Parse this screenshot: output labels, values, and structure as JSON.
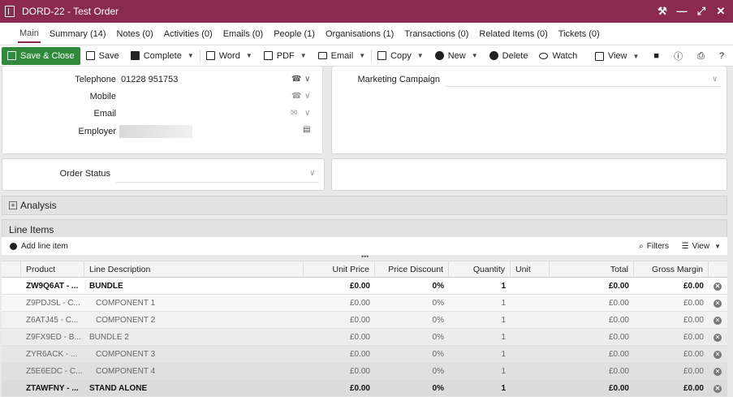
{
  "window": {
    "title": "DORD-22 - Test Order"
  },
  "tabs": [
    {
      "label": "Main"
    },
    {
      "label": "Summary (14)"
    },
    {
      "label": "Notes (0)"
    },
    {
      "label": "Activities (0)"
    },
    {
      "label": "Emails (0)"
    },
    {
      "label": "People (1)"
    },
    {
      "label": "Organisations (1)"
    },
    {
      "label": "Transactions (0)"
    },
    {
      "label": "Related Items (0)"
    },
    {
      "label": "Tickets (0)"
    }
  ],
  "toolbar": {
    "save_close": "Save & Close",
    "save": "Save",
    "complete": "Complete",
    "word": "Word",
    "pdf": "PDF",
    "email": "Email",
    "copy": "Copy",
    "new": "New",
    "delete": "Delete",
    "watch": "Watch",
    "view": "View"
  },
  "contact": {
    "telephone_label": "Telephone",
    "telephone_value": "01228 951753",
    "mobile_label": "Mobile",
    "email_label": "Email",
    "employer_label": "Employer"
  },
  "marketing": {
    "label": "Marketing Campaign"
  },
  "order": {
    "status_label": "Order Status"
  },
  "analysis": {
    "label": "Analysis"
  },
  "line_items": {
    "title": "Line Items",
    "add_label": "Add line item",
    "filters_label": "Filters",
    "view_label": "View",
    "columns": [
      "Product",
      "Line Description",
      "Unit Price",
      "Price Discount",
      "Quantity",
      "Unit",
      "Total",
      "Gross Margin"
    ],
    "rows": [
      {
        "product": "ZW9Q6AT - ...",
        "desc": "BUNDLE",
        "unit_price": "£0.00",
        "discount": "0%",
        "qty": "1",
        "unit": "",
        "total": "£0.00",
        "margin": "£0.00"
      },
      {
        "product": "Z9PDJSL - C...",
        "desc": "COMPONENT 1",
        "unit_price": "£0.00",
        "discount": "0%",
        "qty": "1",
        "unit": "",
        "total": "£0.00",
        "margin": "£0.00"
      },
      {
        "product": "Z6ATJ45 - C...",
        "desc": "COMPONENT 2",
        "unit_price": "£0.00",
        "discount": "0%",
        "qty": "1",
        "unit": "",
        "total": "£0.00",
        "margin": "£0.00"
      },
      {
        "product": "Z9FX9ED - B...",
        "desc": "BUNDLE 2",
        "unit_price": "£0.00",
        "discount": "0%",
        "qty": "1",
        "unit": "",
        "total": "£0.00",
        "margin": "£0.00"
      },
      {
        "product": "ZYR6ACK - ...",
        "desc": "COMPONENT 3",
        "unit_price": "£0.00",
        "discount": "0%",
        "qty": "1",
        "unit": "",
        "total": "£0.00",
        "margin": "£0.00"
      },
      {
        "product": "Z5E6EDC - C...",
        "desc": "COMPONENT 4",
        "unit_price": "£0.00",
        "discount": "0%",
        "qty": "1",
        "unit": "",
        "total": "£0.00",
        "margin": "£0.00"
      },
      {
        "product": "ZTAWFNY - ...",
        "desc": "STAND ALONE",
        "unit_price": "£0.00",
        "discount": "0%",
        "qty": "1",
        "unit": "",
        "total": "£0.00",
        "margin": "£0.00"
      }
    ]
  },
  "colors": {
    "brand": "#8b2a4f",
    "save_green": "#2f8a3b"
  }
}
